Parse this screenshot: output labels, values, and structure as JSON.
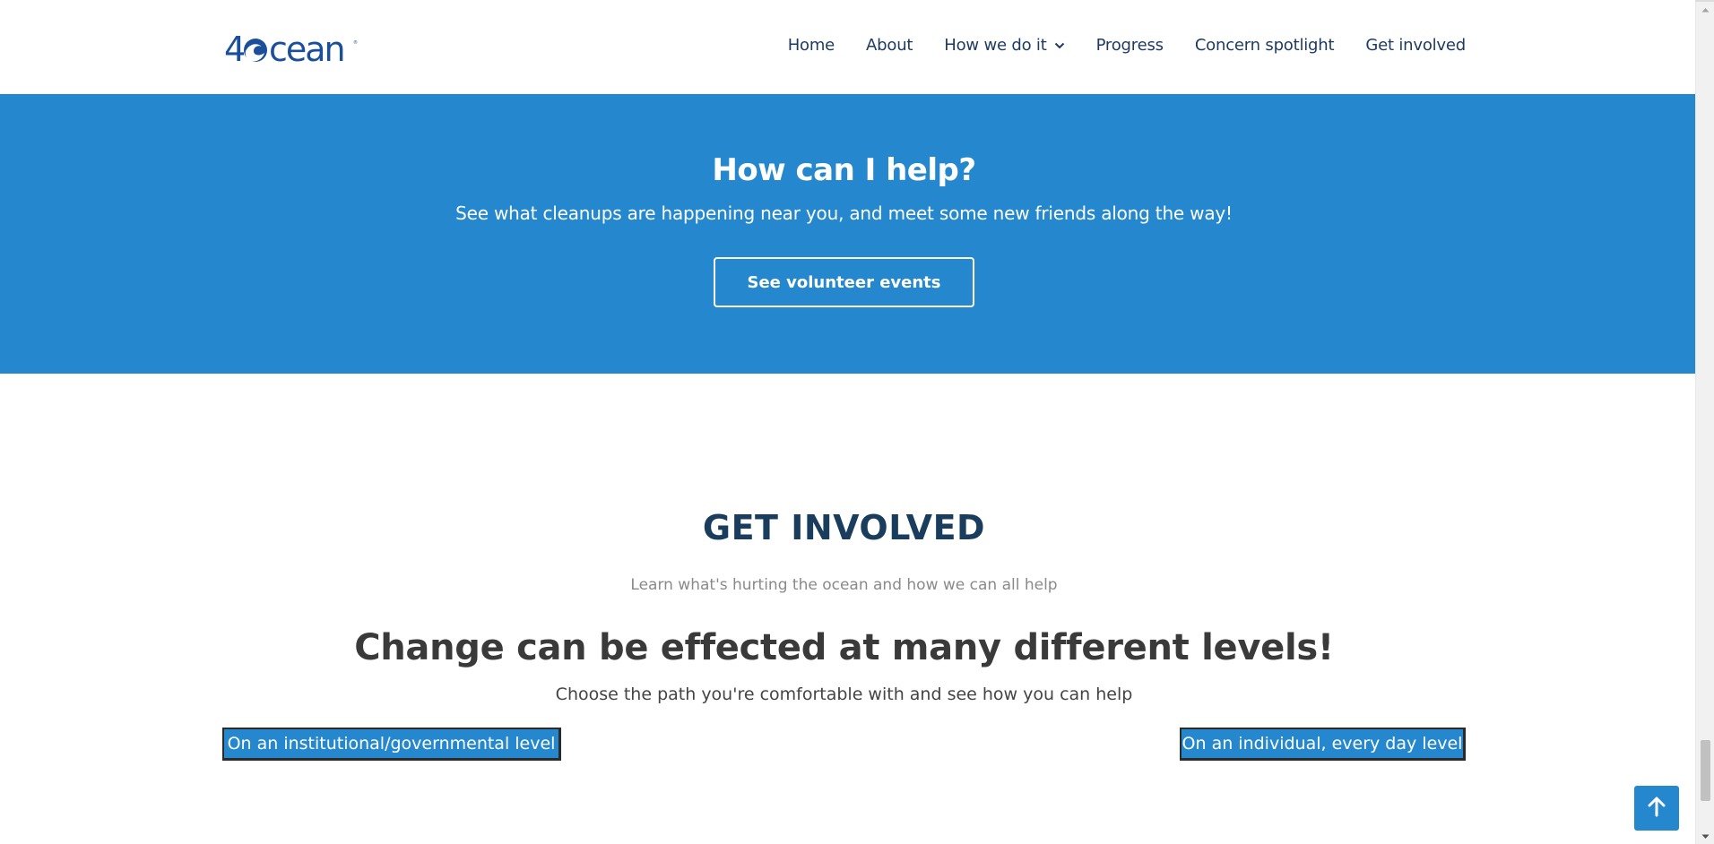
{
  "brand": {
    "logo_text": "4Ocean",
    "accent": "#2588cf",
    "nav_text_color": "#1e3a5f"
  },
  "nav": {
    "items": [
      {
        "label": "Home"
      },
      {
        "label": "About"
      },
      {
        "label": "How we do it",
        "has_dropdown": true
      },
      {
        "label": "Progress"
      },
      {
        "label": "Concern spotlight"
      },
      {
        "label": "Get involved"
      }
    ]
  },
  "hero": {
    "title": "How can I help?",
    "subtitle": "See what cleanups are happening near you, and meet some new friends along the way!",
    "button_label": "See volunteer events"
  },
  "get_involved": {
    "title": "GET INVOLVED",
    "subtitle": "Learn what's hurting the ocean and how we can all help",
    "change_title": "Change can be effected at many different levels!",
    "change_subtitle": "Choose the path you're comfortable with and see how you can help",
    "left_button": "On an institutional/governmental level",
    "right_button": "On an individual, every day level"
  },
  "icons": {
    "dropdown": "chevron-down-icon",
    "back_to_top": "arrow-up-icon"
  }
}
